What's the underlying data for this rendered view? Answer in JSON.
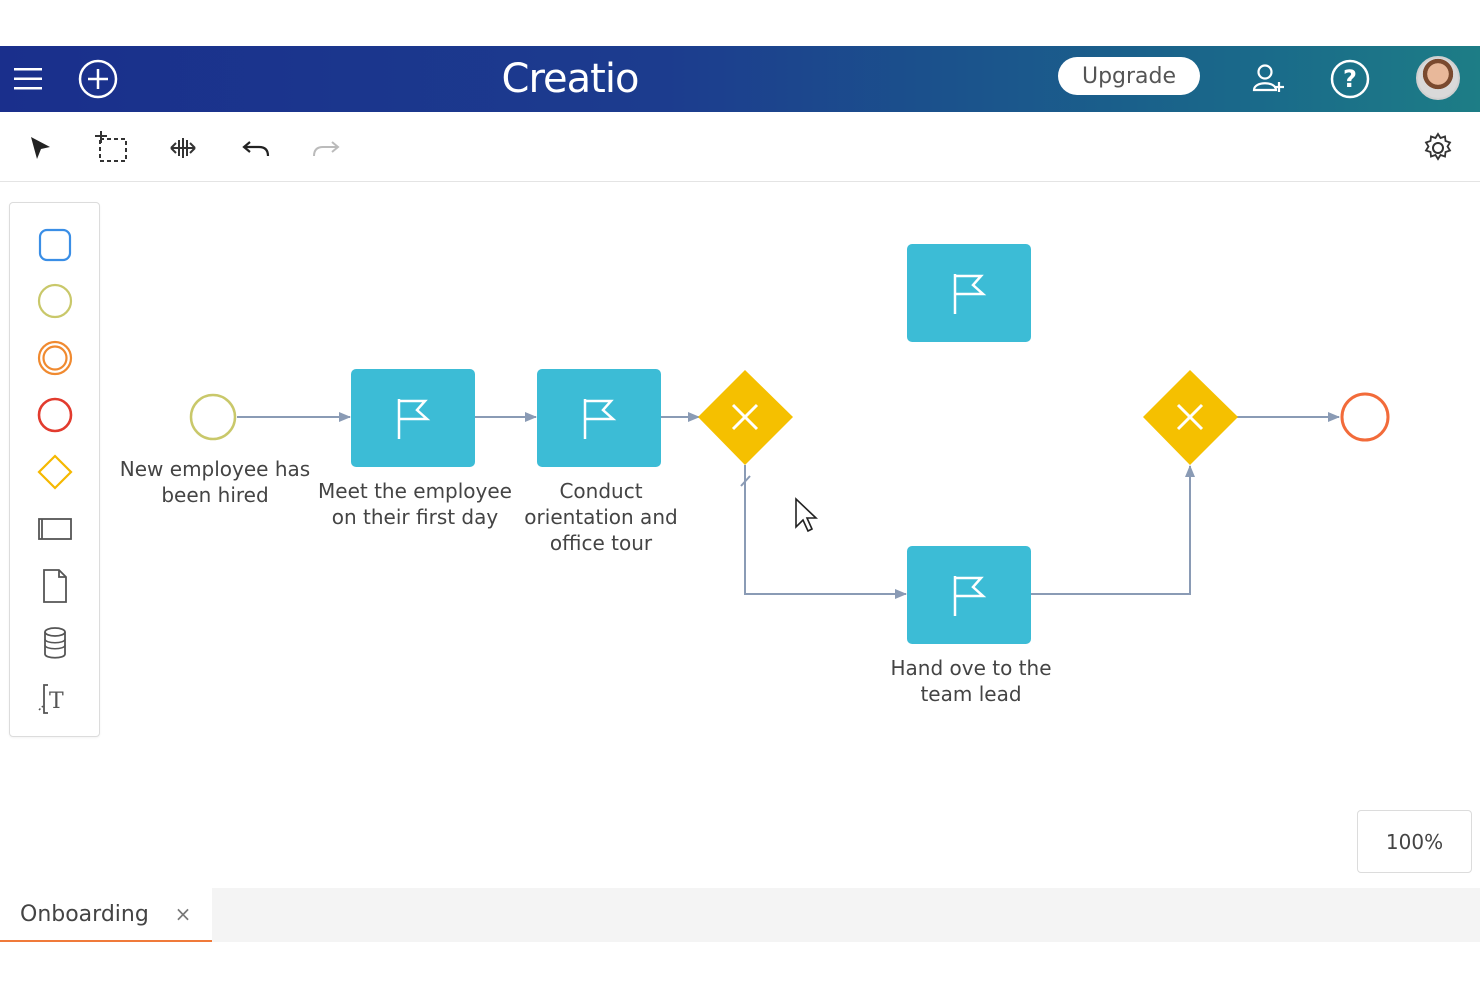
{
  "header": {
    "logo_text": "Creatio",
    "upgrade_label": "Upgrade",
    "menu_icon": "hamburger-menu-icon",
    "add_icon": "plus-circle-icon",
    "invite_icon": "add-user-icon",
    "help_icon": "help-circle-icon",
    "avatar": "user-avatar",
    "gradient_start": "#1a2f8c",
    "gradient_end": "#1d7d86"
  },
  "toolbar": {
    "tools": [
      "select-arrow-icon",
      "lasso-select-icon",
      "move-canvas-icon",
      "undo-icon",
      "redo-icon"
    ],
    "settings_icon": "gear-icon"
  },
  "palette": {
    "items": [
      "task-shape-icon",
      "start-event-icon",
      "intermediate-event-icon",
      "end-event-icon",
      "gateway-icon",
      "subprocess-icon",
      "data-object-icon",
      "data-store-icon",
      "text-annotation-icon"
    ]
  },
  "diagram": {
    "start_event_label": "New employee has been hired",
    "task1_label": "Meet the employee on their first day",
    "task2_label": "Conduct orientation and office tour",
    "task3_label": "",
    "task4_label": "Hand ove to the team lead",
    "task_color": "#3cbcd6",
    "gateway_color": "#f5c000",
    "start_color": "#c9c86a",
    "end_color": "#f26b3a",
    "connector_color": "#8a9bb5"
  },
  "zoom": {
    "level": "100%"
  },
  "tabs": [
    {
      "label": "Onboarding",
      "close": "×"
    }
  ]
}
